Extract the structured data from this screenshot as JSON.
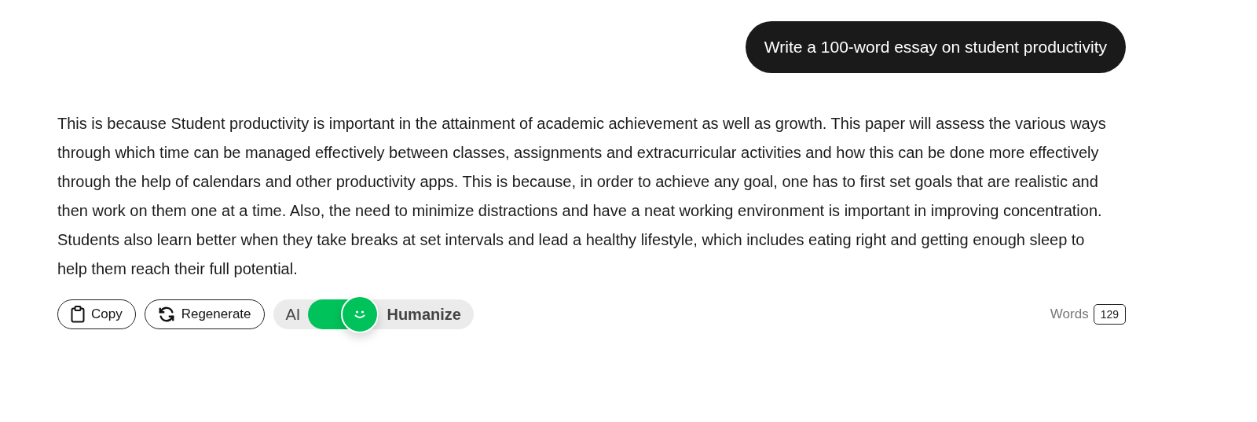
{
  "prompt": {
    "text": "Write a 100-word essay on student productivity"
  },
  "response": {
    "text": "This is because Student productivity is important in the attainment of academic achievement as well as growth. This paper will assess the various ways through which time can be managed effectively between classes, assignments and extracurricular activities and how this can be done more effectively through the help of calendars and other productivity apps. This is because, in order to achieve any goal, one has to first set goals that are realistic and then work on them one at a time. Also, the need to minimize distractions and have a neat working environment is important in improving concentration. Students also learn better when they take breaks at set intervals and lead a healthy lifestyle, which includes eating right and getting enough sleep to help them reach their full potential."
  },
  "actions": [
    {
      "label": "Copy",
      "kind": "copy"
    },
    {
      "label": "Regenerate",
      "kind": "regenerate"
    }
  ],
  "humanize_toggle": {
    "left_label": "AI",
    "right_label": "Humanize",
    "on": true
  },
  "word_count": {
    "label": "Words",
    "value": "129"
  }
}
